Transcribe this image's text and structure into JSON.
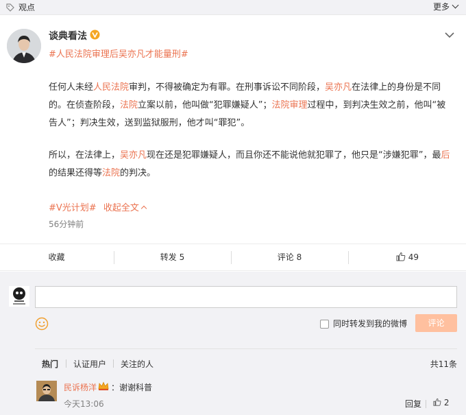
{
  "topbar": {
    "tag": "观点",
    "more": "更多"
  },
  "post": {
    "author": "谈典看法",
    "topic": "#人民法院审理后吴亦凡才能量刑#",
    "para1": [
      {
        "t": "任何人未经",
        "hl": false
      },
      {
        "t": "人民法院",
        "hl": true
      },
      {
        "t": "审判，不得被确定为有罪。在刑事诉讼不同阶段，",
        "hl": false
      },
      {
        "t": "吴亦凡",
        "hl": true
      },
      {
        "t": "在法律上的身份是不同的。在侦查阶段，",
        "hl": false
      },
      {
        "t": "法院",
        "hl": true
      },
      {
        "t": "立案以前，他叫做“犯罪嫌疑人”；",
        "hl": false
      },
      {
        "t": "法院审理",
        "hl": true
      },
      {
        "t": "过程中，到判决生效之前，他叫“被告人”；判决生效，送到监狱服刑，他才叫“罪犯”。",
        "hl": false
      }
    ],
    "para2": [
      {
        "t": "所以，在法律上，",
        "hl": false
      },
      {
        "t": "吴亦凡",
        "hl": true
      },
      {
        "t": "现在还是犯罪嫌疑人，而且你还不能说他就犯罪了，他只是“涉嫌犯罪”，最",
        "hl": false
      },
      {
        "t": "后",
        "hl": true
      },
      {
        "t": "的结果还得等",
        "hl": false
      },
      {
        "t": "法院",
        "hl": true
      },
      {
        "t": "的判决。",
        "hl": false
      }
    ],
    "tag": "#V光计划#",
    "collapse": "收起全文",
    "time": "56分钟前"
  },
  "actions": {
    "favorite": "收藏",
    "repost": "转发 5",
    "comment": "评论 8",
    "like": "49"
  },
  "composer": {
    "repost_label": "同时转发到我的微博",
    "submit": "评论"
  },
  "filters": {
    "hot": "热门",
    "verified": "认证用户",
    "following": "关注的人",
    "total": "共11条"
  },
  "comment": {
    "user": "民诉杨洋",
    "text": "：谢谢科普",
    "time": "今天13:06",
    "reply": "回复",
    "likes": "2"
  },
  "colors": {
    "accent": "#eb7350",
    "background": "#f2f2f5",
    "button_disabled": "#ffc09f"
  }
}
